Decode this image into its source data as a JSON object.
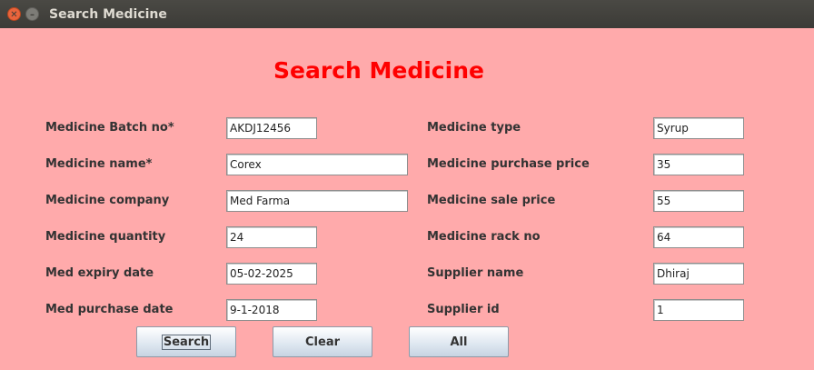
{
  "window": {
    "title": "Search Medicine"
  },
  "heading": "Search Medicine",
  "left_fields": [
    {
      "label": "Medicine Batch no*",
      "value": "AKDJ12456"
    },
    {
      "label": "Medicine name*",
      "value": "Corex"
    },
    {
      "label": "Medicine company",
      "value": "Med Farma"
    },
    {
      "label": "Medicine quantity",
      "value": "24"
    },
    {
      "label": "Med expiry date",
      "value": "05-02-2025"
    },
    {
      "label": "Med purchase date",
      "value": "9-1-2018"
    }
  ],
  "right_fields": [
    {
      "label": "Medicine type",
      "value": "Syrup"
    },
    {
      "label": "Medicine purchase price",
      "value": "35"
    },
    {
      "label": "Medicine sale price",
      "value": "55"
    },
    {
      "label": "Medicine rack no",
      "value": "64"
    },
    {
      "label": "Supplier name",
      "value": "Dhiraj"
    },
    {
      "label": "Supplier id",
      "value": "1"
    }
  ],
  "buttons": {
    "search": "Search",
    "clear": "Clear",
    "all": "All"
  },
  "colors": {
    "background": "#ffaaab",
    "heading": "#ff0000",
    "titlebar": "#3c3b37"
  }
}
